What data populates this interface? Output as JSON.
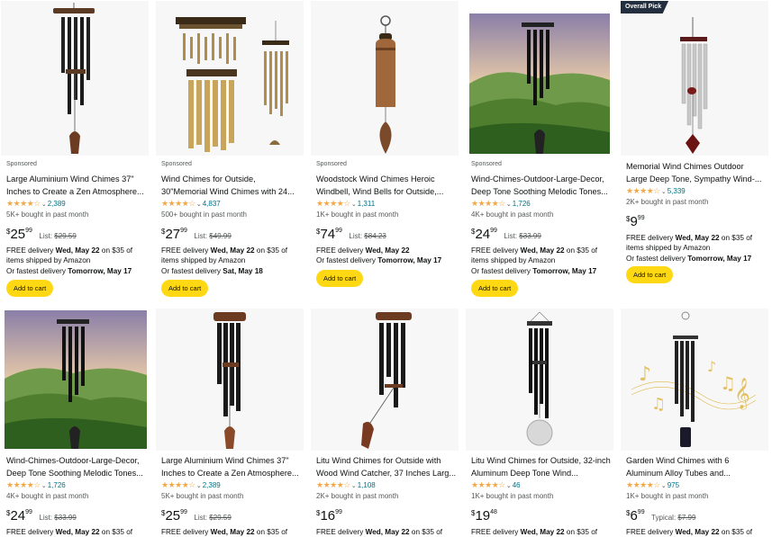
{
  "results": [
    {
      "sponsored": "Sponsored",
      "title": "Large Aluminium Wind Chimes 37\" Inches to Create a Zen Atmosphere...",
      "stars": "★★★★☆",
      "reviews": "2,389",
      "bought": "5K+ bought in past month",
      "price_currency": "$",
      "price_whole": "25",
      "price_fraction": "99",
      "list_label": "List:",
      "list_price": "$29.59",
      "delivery_1": "FREE delivery ",
      "delivery_date": "Wed, May 22",
      "delivery_2": " on $35 of items shipped by Amazon",
      "fastest_1": "Or fastest delivery ",
      "fastest_date": "Tomorrow, May 17",
      "cart": "Add to cart"
    },
    {
      "sponsored": "Sponsored",
      "title": "Wind Chimes for Outside, 30\"Memorial Wind Chimes with 24...",
      "stars": "★★★★☆",
      "reviews": "4,837",
      "bought": "500+ bought in past month",
      "price_currency": "$",
      "price_whole": "27",
      "price_fraction": "99",
      "list_label": "List:",
      "list_price": "$49.99",
      "delivery_1": "FREE delivery ",
      "delivery_date": "Wed, May 22",
      "delivery_2": " on $35 of items shipped by Amazon",
      "fastest_1": "Or fastest delivery ",
      "fastest_date": "Sat, May 18",
      "cart": "Add to cart"
    },
    {
      "sponsored": "Sponsored",
      "title": "Woodstock Wind Chimes Heroic Windbell, Wind Bells for Outside,...",
      "stars": "★★★★☆",
      "reviews": "1,311",
      "bought": "1K+ bought in past month",
      "price_currency": "$",
      "price_whole": "74",
      "price_fraction": "99",
      "list_label": "List:",
      "list_price": "$84.23",
      "delivery_1": "FREE delivery ",
      "delivery_date": "Wed, May 22",
      "delivery_2": "",
      "fastest_1": "Or fastest delivery ",
      "fastest_date": "Tomorrow, May 17",
      "cart": "Add to cart"
    },
    {
      "sponsored": "Sponsored",
      "title": "Wind-Chimes-Outdoor-Large-Decor, Deep Tone Soothing Melodic Tones...",
      "stars": "★★★★☆",
      "reviews": "1,726",
      "bought": "4K+ bought in past month",
      "price_currency": "$",
      "price_whole": "24",
      "price_fraction": "99",
      "list_label": "List:",
      "list_price": "$33.99",
      "delivery_1": "FREE delivery ",
      "delivery_date": "Wed, May 22",
      "delivery_2": " on $35 of items shipped by Amazon",
      "fastest_1": "Or fastest delivery ",
      "fastest_date": "Tomorrow, May 17",
      "cart": "Add to cart"
    },
    {
      "badge": "Overall Pick",
      "title": "Memorial Wind Chimes Outdoor Large Deep Tone, Sympathy Wind-...",
      "stars": "★★★★☆",
      "reviews": "5,339",
      "bought": "2K+ bought in past month",
      "price_currency": "$",
      "price_whole": "9",
      "price_fraction": "99",
      "delivery_1": "FREE delivery ",
      "delivery_date": "Wed, May 22",
      "delivery_2": " on $35 of items shipped by Amazon",
      "fastest_1": "Or fastest delivery ",
      "fastest_date": "Tomorrow, May 17",
      "cart": "Add to cart"
    },
    {
      "title": "Wind-Chimes-Outdoor-Large-Decor, Deep Tone Soothing Melodic Tones...",
      "stars": "★★★★☆",
      "reviews": "1,726",
      "bought": "4K+ bought in past month",
      "price_currency": "$",
      "price_whole": "24",
      "price_fraction": "99",
      "list_label": "List:",
      "list_price": "$33.99",
      "delivery_1": "FREE delivery ",
      "delivery_date": "Wed, May 22",
      "delivery_2": " on $35 of"
    },
    {
      "title": "Large Aluminium Wind Chimes 37\" Inches to Create a Zen Atmosphere...",
      "stars": "★★★★☆",
      "reviews": "2,389",
      "bought": "5K+ bought in past month",
      "price_currency": "$",
      "price_whole": "25",
      "price_fraction": "99",
      "list_label": "List:",
      "list_price": "$29.59",
      "delivery_1": "FREE delivery ",
      "delivery_date": "Wed, May 22",
      "delivery_2": " on $35 of"
    },
    {
      "title": "Litu Wind Chimes for Outside with Wood Wind Catcher, 37 Inches Larg...",
      "stars": "★★★★☆",
      "reviews": "1,108",
      "bought": "2K+ bought in past month",
      "price_currency": "$",
      "price_whole": "16",
      "price_fraction": "99",
      "delivery_1": "FREE delivery ",
      "delivery_date": "Wed, May 22",
      "delivery_2": " on $35 of"
    },
    {
      "title": "Litu Wind Chimes for Outside, 32-inch Aluminum Deep Tone Wind...",
      "stars": "★★★★☆",
      "reviews": "46",
      "bought": "1K+ bought in past month",
      "price_currency": "$",
      "price_whole": "19",
      "price_fraction": "48",
      "delivery_1": "FREE delivery ",
      "delivery_date": "Wed, May 22",
      "delivery_2": " on $35 of"
    },
    {
      "title": "Garden Wind Chimes with 6 Aluminum Alloy Tubes and...",
      "stars": "★★★★☆",
      "reviews": "975",
      "bought": "1K+ bought in past month",
      "price_currency": "$",
      "price_whole": "6",
      "price_fraction": "99",
      "list_label": "Typical:",
      "list_price": "$7.99",
      "delivery_1": "FREE delivery ",
      "delivery_date": "Wed, May 22",
      "delivery_2": " on $35 of"
    }
  ],
  "colors": {
    "accent_link": "#007185",
    "star": "#f3a847",
    "cart_button": "#ffd814",
    "badge_bg": "#232f3e"
  },
  "icons": [
    "chevron-down-icon",
    "star-icon"
  ]
}
